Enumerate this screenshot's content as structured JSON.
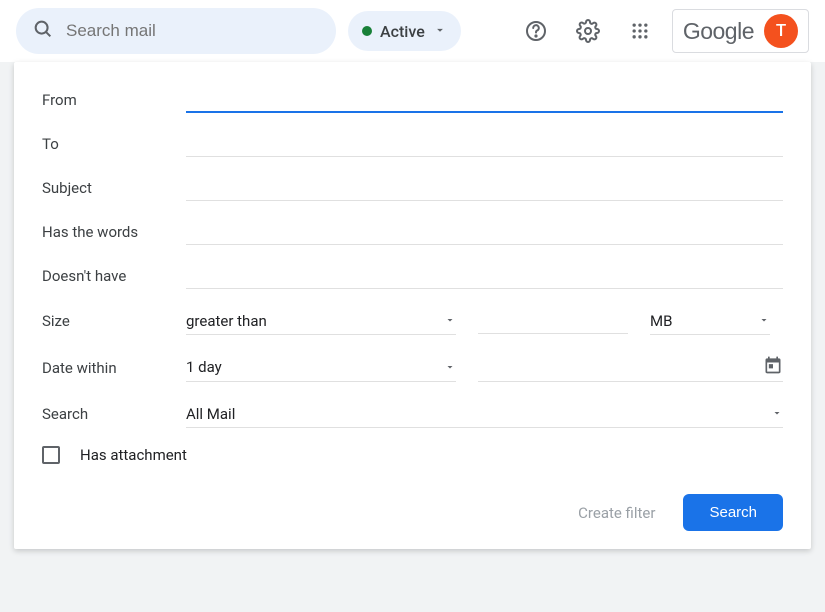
{
  "topbar": {
    "search_placeholder": "Search mail",
    "active_label": "Active",
    "avatar_letter": "T",
    "google_text": "Google"
  },
  "form": {
    "from_label": "From",
    "to_label": "To",
    "subject_label": "Subject",
    "haswords_label": "Has the words",
    "doesnthave_label": "Doesn't have",
    "size_label": "Size",
    "datewithin_label": "Date within",
    "search_label": "Search",
    "size_operator": "greater than",
    "size_unit": "MB",
    "date_range": "1 day",
    "search_scope": "All Mail",
    "attachment_label": "Has attachment"
  },
  "footer": {
    "create_filter": "Create filter",
    "search_button": "Search"
  }
}
